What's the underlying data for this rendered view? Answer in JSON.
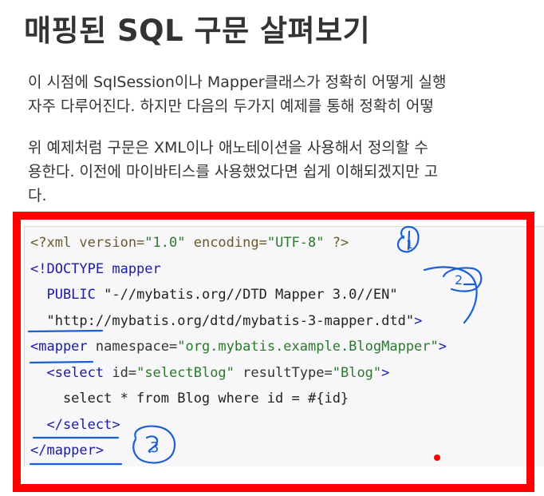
{
  "heading": "매핑된 SQL 구문 살펴보기",
  "paragraphs": [
    {
      "lines": [
        "이 시점에 SqlSession이나 Mapper클래스가 정확히 어떻게 실행",
        "자주 다루어진다. 하지만 다음의 두가지 예제를 통해 정확히 어떻"
      ]
    },
    {
      "lines": [
        "위 예제처럼 구문은 XML이나 애노테이션을 사용해서 정의할 수",
        "용한다. 이전에 마이바티스를 사용했었다면 쉽게 이해되겠지만 고",
        "다."
      ]
    }
  ],
  "code": {
    "lines": [
      [
        {
          "t": "<?xml version=",
          "c": "pi"
        },
        {
          "t": "\"1.0\"",
          "c": "str"
        },
        {
          "t": " encoding=",
          "c": "pi"
        },
        {
          "t": "\"UTF-8\"",
          "c": "str"
        },
        {
          "t": " ?>",
          "c": "pi"
        }
      ],
      [
        {
          "t": "<!DOCTYPE mapper",
          "c": "tag"
        }
      ],
      [
        {
          "t": "  PUBLIC ",
          "c": "tag"
        },
        {
          "t": "\"-//mybatis.org//DTD Mapper 3.0//EN\"",
          "c": "plain"
        }
      ],
      [
        {
          "t": "  ",
          "c": "plain"
        },
        {
          "t": "\"http://mybatis.org/dtd/mybatis-3-mapper.dtd\"",
          "c": "plain"
        },
        {
          "t": ">",
          "c": "tag"
        }
      ],
      [
        {
          "t": "<mapper",
          "c": "tag"
        },
        {
          "t": " namespace=",
          "c": "attr"
        },
        {
          "t": "\"org.mybatis.example.BlogMapper\"",
          "c": "str"
        },
        {
          "t": ">",
          "c": "tag"
        }
      ],
      [
        {
          "t": "  <select",
          "c": "tag"
        },
        {
          "t": " id=",
          "c": "attr"
        },
        {
          "t": "\"selectBlog\"",
          "c": "str"
        },
        {
          "t": " resultType=",
          "c": "attr"
        },
        {
          "t": "\"Blog\"",
          "c": "str"
        },
        {
          "t": ">",
          "c": "tag"
        }
      ],
      [
        {
          "t": "    select * from Blog where id = #{id}",
          "c": "plain"
        }
      ],
      [
        {
          "t": "  </select>",
          "c": "tag"
        }
      ],
      [
        {
          "t": "</mapper>",
          "c": "tag"
        }
      ]
    ]
  },
  "annotations": {
    "marker_1": "1",
    "marker_2": "2",
    "marker_3": "3",
    "frame_color": "#ff0000",
    "pen_color": "#1a5fd6"
  }
}
